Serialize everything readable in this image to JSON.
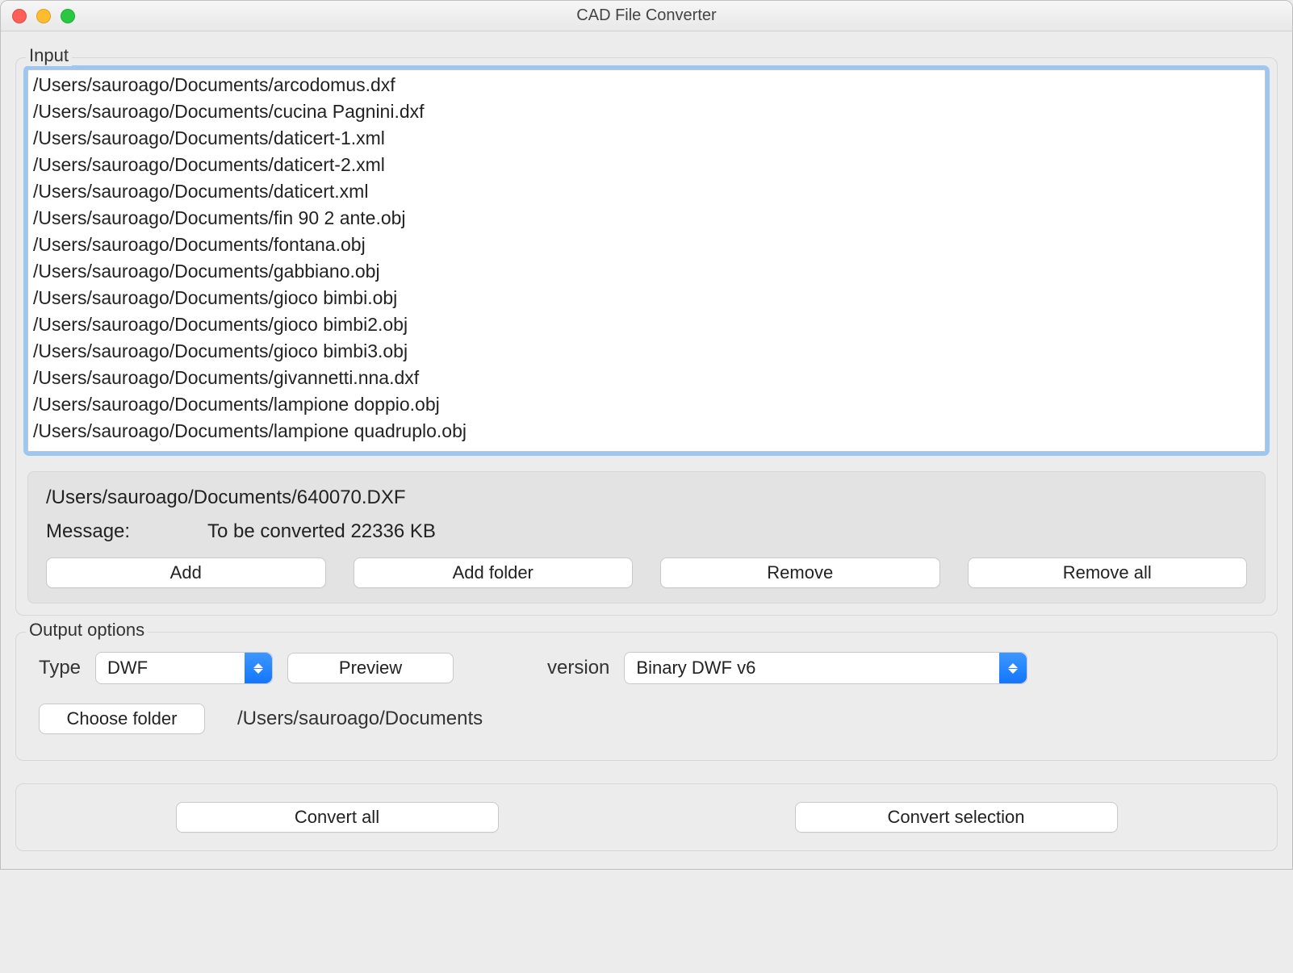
{
  "window": {
    "title": "CAD File Converter"
  },
  "input": {
    "group_label": "Input",
    "files": [
      "/Users/sauroago/Documents/arcodomus.dxf",
      "/Users/sauroago/Documents/cucina Pagnini.dxf",
      "/Users/sauroago/Documents/daticert-1.xml",
      "/Users/sauroago/Documents/daticert-2.xml",
      "/Users/sauroago/Documents/daticert.xml",
      "/Users/sauroago/Documents/fin 90 2 ante.obj",
      "/Users/sauroago/Documents/fontana.obj",
      "/Users/sauroago/Documents/gabbiano.obj",
      "/Users/sauroago/Documents/gioco bimbi.obj",
      "/Users/sauroago/Documents/gioco bimbi2.obj",
      "/Users/sauroago/Documents/gioco bimbi3.obj",
      "/Users/sauroago/Documents/givannetti.nna.dxf",
      "/Users/sauroago/Documents/lampione doppio.obj",
      "/Users/sauroago/Documents/lampione quadruplo.obj"
    ],
    "current_file": "/Users/sauroago/Documents/640070.DXF",
    "message_label": "Message:",
    "message_value": "To be converted 22336 KB",
    "buttons": {
      "add": "Add",
      "add_folder": "Add folder",
      "remove": "Remove",
      "remove_all": "Remove all"
    }
  },
  "output": {
    "group_label": "Output options",
    "type_label": "Type",
    "type_value": "DWF",
    "preview_label": "Preview",
    "version_label": "version",
    "version_value": "Binary DWF v6",
    "choose_folder_label": "Choose folder",
    "folder_path": "/Users/sauroago/Documents"
  },
  "actions": {
    "convert_all": "Convert all",
    "convert_selection": "Convert selection"
  }
}
